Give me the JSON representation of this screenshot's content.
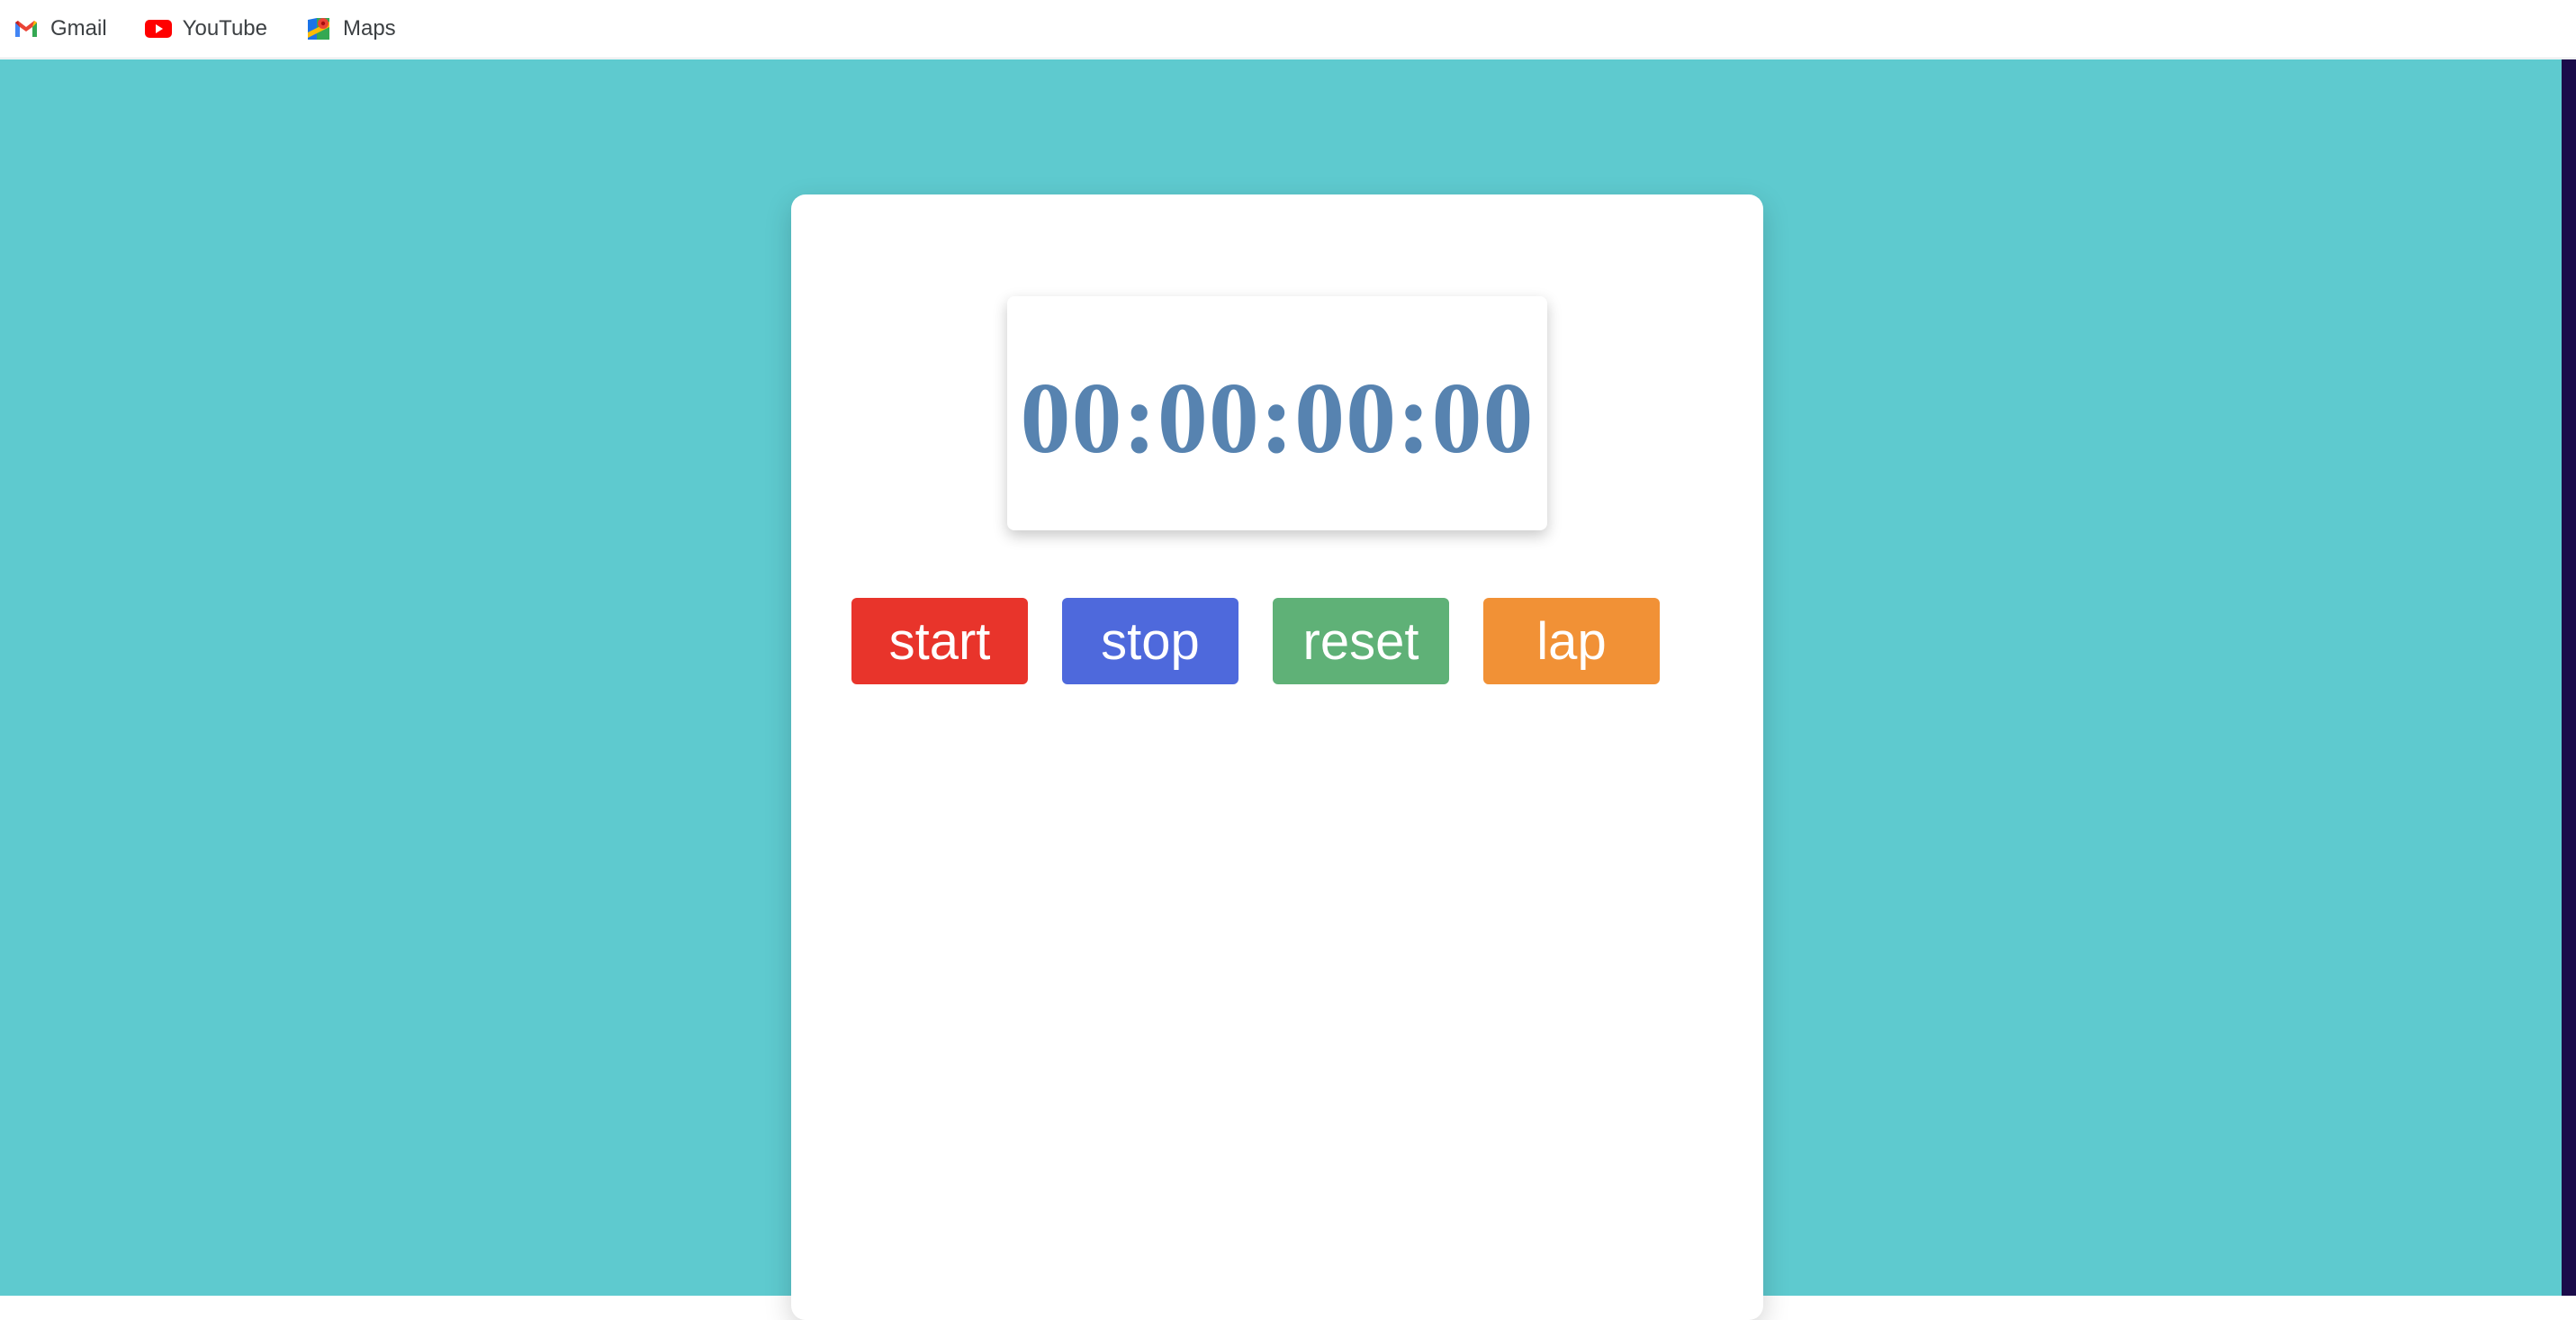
{
  "bookmarks": [
    {
      "label": "Gmail",
      "icon": "gmail-icon"
    },
    {
      "label": "YouTube",
      "icon": "youtube-icon"
    },
    {
      "label": "Maps",
      "icon": "maps-icon"
    }
  ],
  "stopwatch": {
    "time": "00:00:00:00",
    "buttons": {
      "start": {
        "label": "start",
        "color": "#e8342b"
      },
      "stop": {
        "label": "stop",
        "color": "#4e69dc"
      },
      "reset": {
        "label": "reset",
        "color": "#5fb177"
      },
      "lap": {
        "label": "lap",
        "color": "#f19136"
      }
    }
  },
  "colors": {
    "page_background": "#5ecacf",
    "time_text": "#5783b0"
  }
}
